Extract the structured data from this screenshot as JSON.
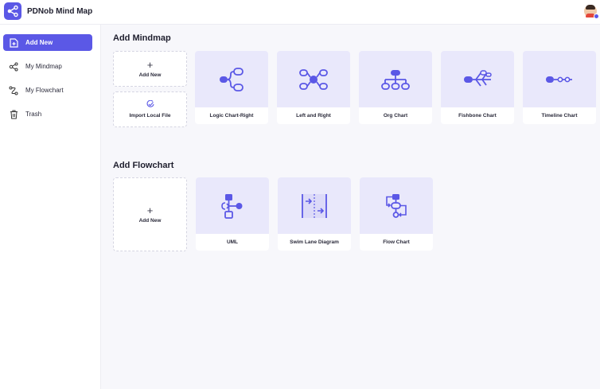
{
  "app": {
    "title": "PDNob Mind Map"
  },
  "sidebar": {
    "items": [
      {
        "label": "Add New",
        "icon": "file-add-icon",
        "active": true
      },
      {
        "label": "My Mindmap",
        "icon": "share-nodes-icon"
      },
      {
        "label": "My Flowchart",
        "icon": "flow-path-icon"
      },
      {
        "label": "Trash",
        "icon": "trash-icon"
      }
    ]
  },
  "mindmap": {
    "title": "Add Mindmap",
    "add_new": "Add New",
    "import": "Import Local File",
    "templates": [
      {
        "label": "Logic Chart-Right",
        "icon": "logic-chart-icon"
      },
      {
        "label": "Left and Right",
        "icon": "left-right-icon"
      },
      {
        "label": "Org Chart",
        "icon": "org-chart-icon"
      },
      {
        "label": "Fishbone Chart",
        "icon": "fishbone-icon"
      },
      {
        "label": "Timeline Chart",
        "icon": "timeline-icon"
      }
    ]
  },
  "flowchart": {
    "title": "Add Flowchart",
    "add_new": "Add New",
    "templates": [
      {
        "label": "UML",
        "icon": "uml-icon"
      },
      {
        "label": "Swim Lane Diagram",
        "icon": "swim-lane-icon"
      },
      {
        "label": "Flow Chart",
        "icon": "flow-chart-icon"
      }
    ]
  },
  "colors": {
    "accent": "#5b58e6",
    "thumb_bg": "#e9e8fb"
  }
}
